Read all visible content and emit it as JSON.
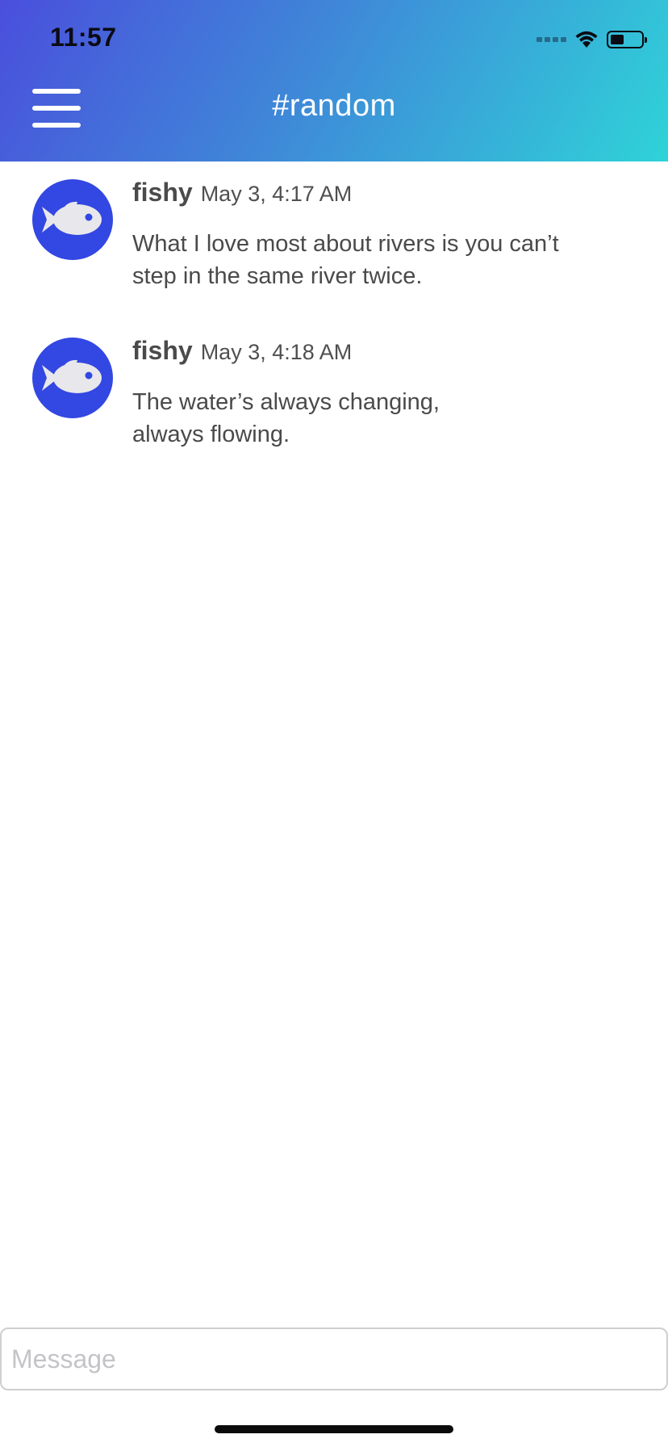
{
  "status_bar": {
    "time": "11:57",
    "icons": [
      "cellular-signal-icon",
      "wifi-icon",
      "battery-icon"
    ]
  },
  "header": {
    "menu_icon": "hamburger-menu-icon",
    "channel_title": "#random",
    "gradient_colors": [
      "#4a4fdc",
      "#3f87d8",
      "#2fd3d8"
    ]
  },
  "messages": [
    {
      "author": "fishy",
      "timestamp": "May 3, 4:17 AM",
      "avatar_icon": "fish-icon",
      "text_lines": [
        "What I love most about rivers is you can’t",
        "step in the same river twice."
      ]
    },
    {
      "author": "fishy",
      "timestamp": "May 3, 4:18 AM",
      "avatar_icon": "fish-icon",
      "text_lines": [
        "The water’s always changing,",
        "always flowing."
      ]
    }
  ],
  "composer": {
    "placeholder": "Message",
    "value": ""
  },
  "colors": {
    "avatar_bg": "#3347e2",
    "text": "#4a4a4a"
  }
}
